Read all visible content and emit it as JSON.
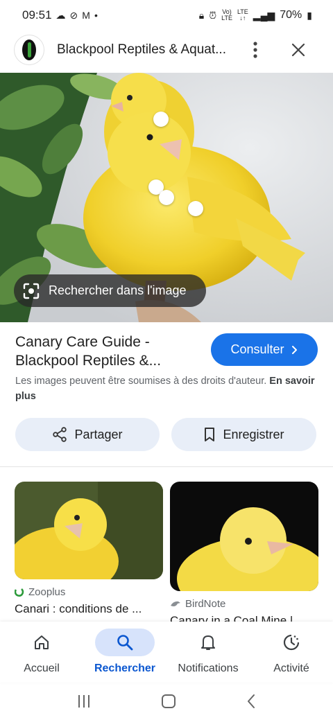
{
  "status_bar": {
    "time": "09:51",
    "battery": "70%",
    "network": "LTE"
  },
  "header": {
    "site_title": "Blackpool Reptiles & Aquat..."
  },
  "image": {
    "lens_chip_label": "Rechercher dans l'image"
  },
  "result": {
    "title_line1": "Canary Care Guide -",
    "title_line2": "Blackpool Reptiles &...",
    "visit_label": "Consulter",
    "copyright_text": "Les images peuvent être soumises à des droits d'auteur.",
    "learn_more": "En savoir plus",
    "share_label": "Partager",
    "save_label": "Enregistrer"
  },
  "related": [
    {
      "source": "Zooplus",
      "title": "Canari : conditions de ..."
    },
    {
      "source": "BirdNote",
      "title": "Canary in a Coal Mine |"
    }
  ],
  "bottom_nav": [
    {
      "label": "Accueil",
      "icon": "home-icon"
    },
    {
      "label": "Rechercher",
      "icon": "search-icon",
      "active": true
    },
    {
      "label": "Notifications",
      "icon": "bell-icon"
    },
    {
      "label": "Activité",
      "icon": "history-icon"
    }
  ],
  "colors": {
    "accent": "#1a73e8",
    "nav_active": "#0b57d0",
    "pill_bg": "#e8eef8",
    "canary_yellow": "#f4d83a"
  }
}
